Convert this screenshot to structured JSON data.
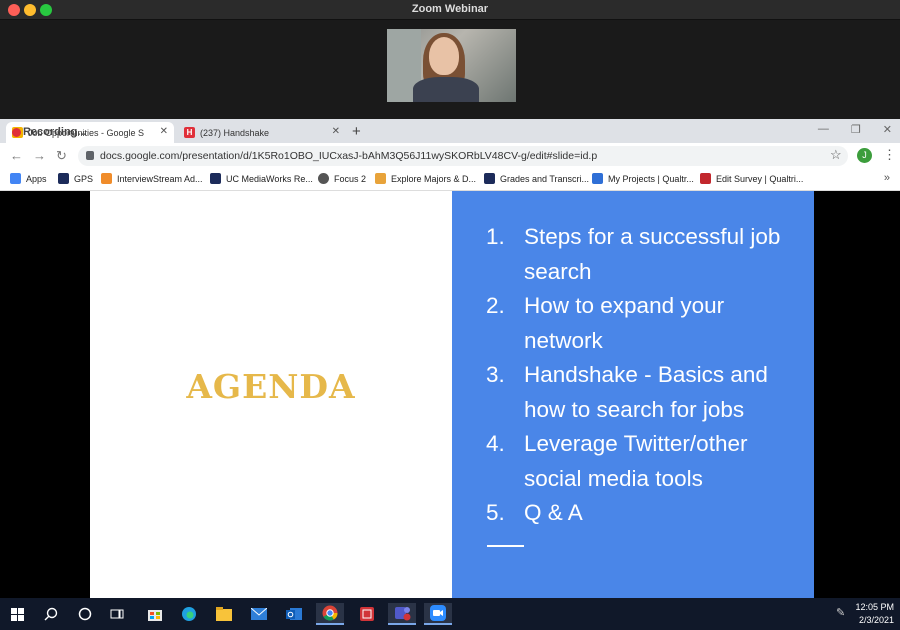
{
  "window": {
    "title": "Zoom Webinar"
  },
  "browser": {
    "tabs": [
      {
        "label": "Job Opportunities - Google S",
        "icon": "google-slides-icon",
        "active": true
      },
      {
        "label": "(237) Handshake",
        "icon": "handshake-icon",
        "active": false
      }
    ],
    "recording_label": "Recording...",
    "url": "docs.google.com/presentation/d/1K5Ro1OBO_IUCxasJ-bAhM3Q56J11wySKORbLV48CV-g/edit#slide=id.p",
    "profile_initial": "J",
    "bookmarks": [
      {
        "label": "Apps",
        "color": "#4285f4"
      },
      {
        "label": "GPS",
        "color": "#1c2b5a"
      },
      {
        "label": "InterviewStream Ad...",
        "color": "#f08c2a"
      },
      {
        "label": "UC MediaWorks Re...",
        "color": "#1c2b5a"
      },
      {
        "label": "Focus 2",
        "color": "#555555"
      },
      {
        "label": "Explore Majors & D...",
        "color": "#e8a33a"
      },
      {
        "label": "Grades and Transcri...",
        "color": "#1c2b5a"
      },
      {
        "label": "My Projects | Qualtr...",
        "color": "#2f6fd6"
      },
      {
        "label": "Edit Survey | Qualtri...",
        "color": "#c2272d"
      }
    ],
    "more_label": "»"
  },
  "slide": {
    "title": "AGENDA",
    "items": [
      {
        "num": "1.",
        "text": "Steps for a successful job search"
      },
      {
        "num": "2.",
        "text": "How to expand your network"
      },
      {
        "num": "3.",
        "text": "Handshake - Basics and how to search for jobs"
      },
      {
        "num": "4.",
        "text": "Leverage Twitter/other social media tools"
      },
      {
        "num": "5.",
        "text": "Q & A"
      }
    ],
    "colors": {
      "title": "#e6b84a",
      "panel": "#4a86e8"
    }
  },
  "taskbar": {
    "time": "12:05 PM",
    "date": "2/3/2021",
    "apps": [
      "windows-start-icon",
      "search-icon",
      "cortana-icon",
      "task-view-icon",
      "store-icon",
      "edge-icon",
      "file-explorer-icon",
      "mail-icon",
      "outlook-icon",
      "chrome-icon",
      "app-red-icon",
      "teams-icon",
      "zoom-icon"
    ]
  }
}
